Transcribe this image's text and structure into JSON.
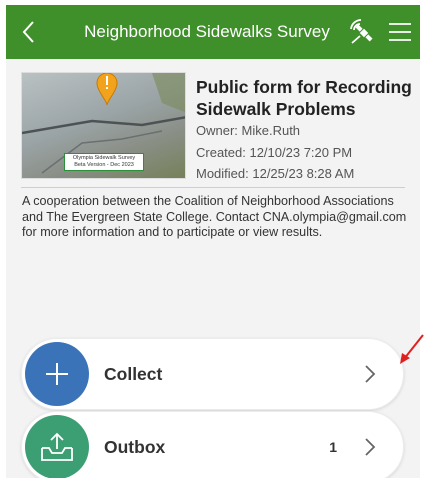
{
  "header": {
    "title": "Neighborhood Sidewalks Survey",
    "back_icon": "chevron-left-icon",
    "satellite_icon": "satellite-icon",
    "menu_icon": "hamburger-menu-icon",
    "background_color": "#3f8f2a"
  },
  "form": {
    "title": "Public form for Recording Sidewalk Problems",
    "owner": "Owner: Mike.Ruth",
    "created": "Created: 12/10/23 7:20 PM",
    "modified": "Modified: 12/25/23 8:28 AM",
    "thumbnail_label_line1": "Olympia Sidewalk Survey",
    "thumbnail_label_line2": "Beta Version - Dec 2023",
    "description": "A cooperation between the Coalition of Neighborhood Associations and The Evergreen State College. Contact CNA.olympia@gmail.com for more information and to participate or view results."
  },
  "actions": [
    {
      "label": "Collect",
      "icon": "plus-icon",
      "count": "",
      "color": "#3a73b7"
    },
    {
      "label": "Outbox",
      "icon": "outbox-upload-icon",
      "count": "1",
      "color": "#3c9e73"
    }
  ],
  "annotation": {
    "arrow_color": "#e02020"
  }
}
